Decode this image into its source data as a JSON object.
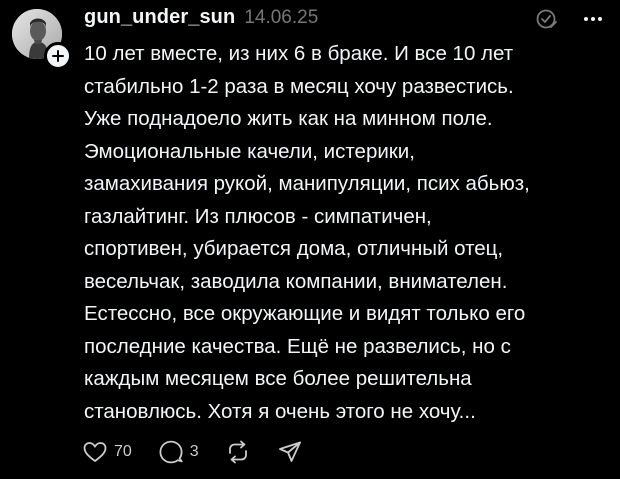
{
  "post": {
    "username": "gun_under_sun",
    "timestamp": "14.06.25",
    "avatar_icon": "portrait-photo",
    "follow_icon": "plus-icon",
    "top_icons": [
      "threads-icon",
      "more-icon"
    ],
    "body_lines": [
      "10 лет вместе, из них 6 в браке. И все 10 лет",
      "стабильно 1-2 раза в месяц хочу развестись.",
      "Уже поднадоело жить как на минном поле.",
      "Эмоциональные качели, истерики,",
      "замахивания рукой, манипуляции, псих абьюз,",
      "газлайтинг. Из плюсов - симпатичен,",
      "спортивен, убирается дома, отличный отец,",
      "весельчак, заводила компании, внимателен.",
      "Естессно, все окружающие и видят только его",
      "последние качества. Ещё не развелись, но с",
      "каждым месяцем все более решительна",
      "становлюсь. Хотя я очень этого не хочу..."
    ],
    "actions": {
      "like_count": "70",
      "reply_count": "3",
      "like_icon": "heart-icon",
      "reply_icon": "comment-icon",
      "repost_icon": "repost-icon",
      "share_icon": "send-icon"
    }
  },
  "colors": {
    "background": "#000000",
    "text": "#f3f5f7",
    "secondary": "#777777"
  }
}
